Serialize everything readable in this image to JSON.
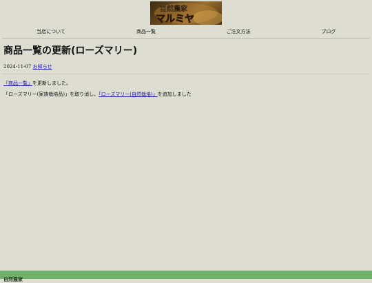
{
  "logo": {
    "line1": "自然農家",
    "line2": "マルミヤ"
  },
  "nav": {
    "items": [
      {
        "label": "当店について"
      },
      {
        "label": "商品一覧"
      },
      {
        "label": "ご注文方法"
      },
      {
        "label": "ブログ"
      }
    ]
  },
  "article": {
    "title": "商品一覧の更新(ローズマリー)",
    "date": "2024-11-07",
    "category": "お知らせ",
    "line1": {
      "link": "「商品一覧」",
      "text": "を更新しました。"
    },
    "line2": {
      "text_before": "「ローズマリー(家族栽培品)」を取り消し、",
      "link": "「ローズマリー(自然栽培)」",
      "text_after": "を追加しました"
    }
  },
  "footer": {
    "text": "自然農家"
  }
}
